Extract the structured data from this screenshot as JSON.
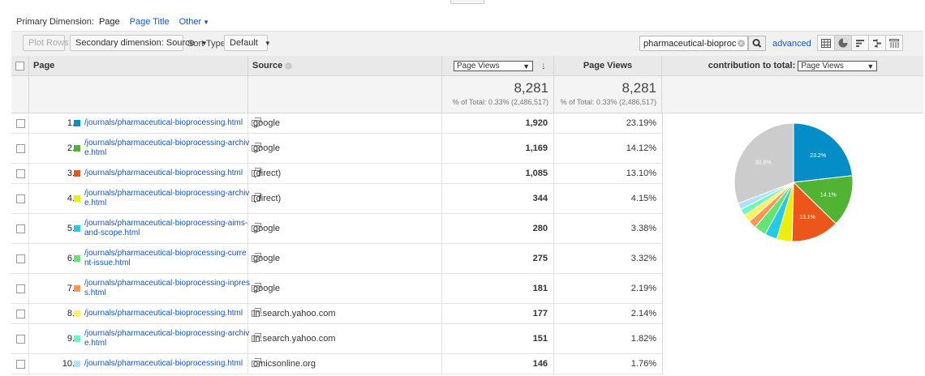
{
  "dimension_bar": {
    "label": "Primary Dimension:",
    "current": "Page",
    "option1": "Page Title",
    "option2": "Other"
  },
  "toolbar": {
    "plot_rows": "Plot Rows",
    "secondary_dimension": "Secondary dimension: Source",
    "sort_type_label": "Sort Type:",
    "sort_type_value": "Default",
    "search_value": "pharmaceutical-bioprocessing",
    "advanced": "advanced"
  },
  "header": {
    "page": "Page",
    "source": "Source",
    "metric_select": "Page Views",
    "page_views": "Page Views",
    "contribution_label": "contribution to total:",
    "contribution_select": "Page Views"
  },
  "totals": {
    "col1_value": "8,281",
    "col1_sub": "% of Total: 0.33% (2,486,517)",
    "col2_value": "8,281",
    "col2_sub": "% of Total: 0.33% (2,486,517)"
  },
  "rows": [
    {
      "num": "1.",
      "page": "/journals/pharmaceutical-bioprocessing.html",
      "source": "google",
      "views": "1,920",
      "pct": "23.19%",
      "color": "#058dc7"
    },
    {
      "num": "2.",
      "page": "/journals/pharmaceutical-bioprocessing-archive.html",
      "source": "google",
      "views": "1,169",
      "pct": "14.12%",
      "color": "#50b432"
    },
    {
      "num": "3.",
      "page": "/journals/pharmaceutical-bioprocessing.html",
      "source": "(direct)",
      "views": "1,085",
      "pct": "13.10%",
      "color": "#ed561b"
    },
    {
      "num": "4.",
      "page": "/journals/pharmaceutical-bioprocessing-archive.html",
      "source": "(direct)",
      "views": "344",
      "pct": "4.15%",
      "color": "#edef00"
    },
    {
      "num": "5.",
      "page": "/journals/pharmaceutical-bioprocessing-aims-and-scope.html",
      "source": "google",
      "views": "280",
      "pct": "3.38%",
      "color": "#24cbe5"
    },
    {
      "num": "6.",
      "page": "/journals/pharmaceutical-bioprocessing-current-issue.html",
      "source": "google",
      "views": "275",
      "pct": "3.32%",
      "color": "#64e572"
    },
    {
      "num": "7.",
      "page": "/journals/pharmaceutical-bioprocessing-inpress.html",
      "source": "google",
      "views": "181",
      "pct": "2.19%",
      "color": "#ff9655"
    },
    {
      "num": "8.",
      "page": "/journals/pharmaceutical-bioprocessing.html",
      "source": "in.search.yahoo.com",
      "views": "177",
      "pct": "2.14%",
      "color": "#fff263"
    },
    {
      "num": "9.",
      "page": "/journals/pharmaceutical-bioprocessing-archive.html",
      "source": "in.search.yahoo.com",
      "views": "151",
      "pct": "1.82%",
      "color": "#6af9c4"
    },
    {
      "num": "10.",
      "page": "/journals/pharmaceutical-bioprocessing.html",
      "source": "omicsonline.org",
      "views": "146",
      "pct": "1.76%",
      "color": "#b2deff"
    }
  ],
  "pie": {
    "labels": [
      "23.2%",
      "14.1%",
      "13.1%",
      "30.8%"
    ],
    "other_color": "#cccccc",
    "other_pct": 30.8
  }
}
